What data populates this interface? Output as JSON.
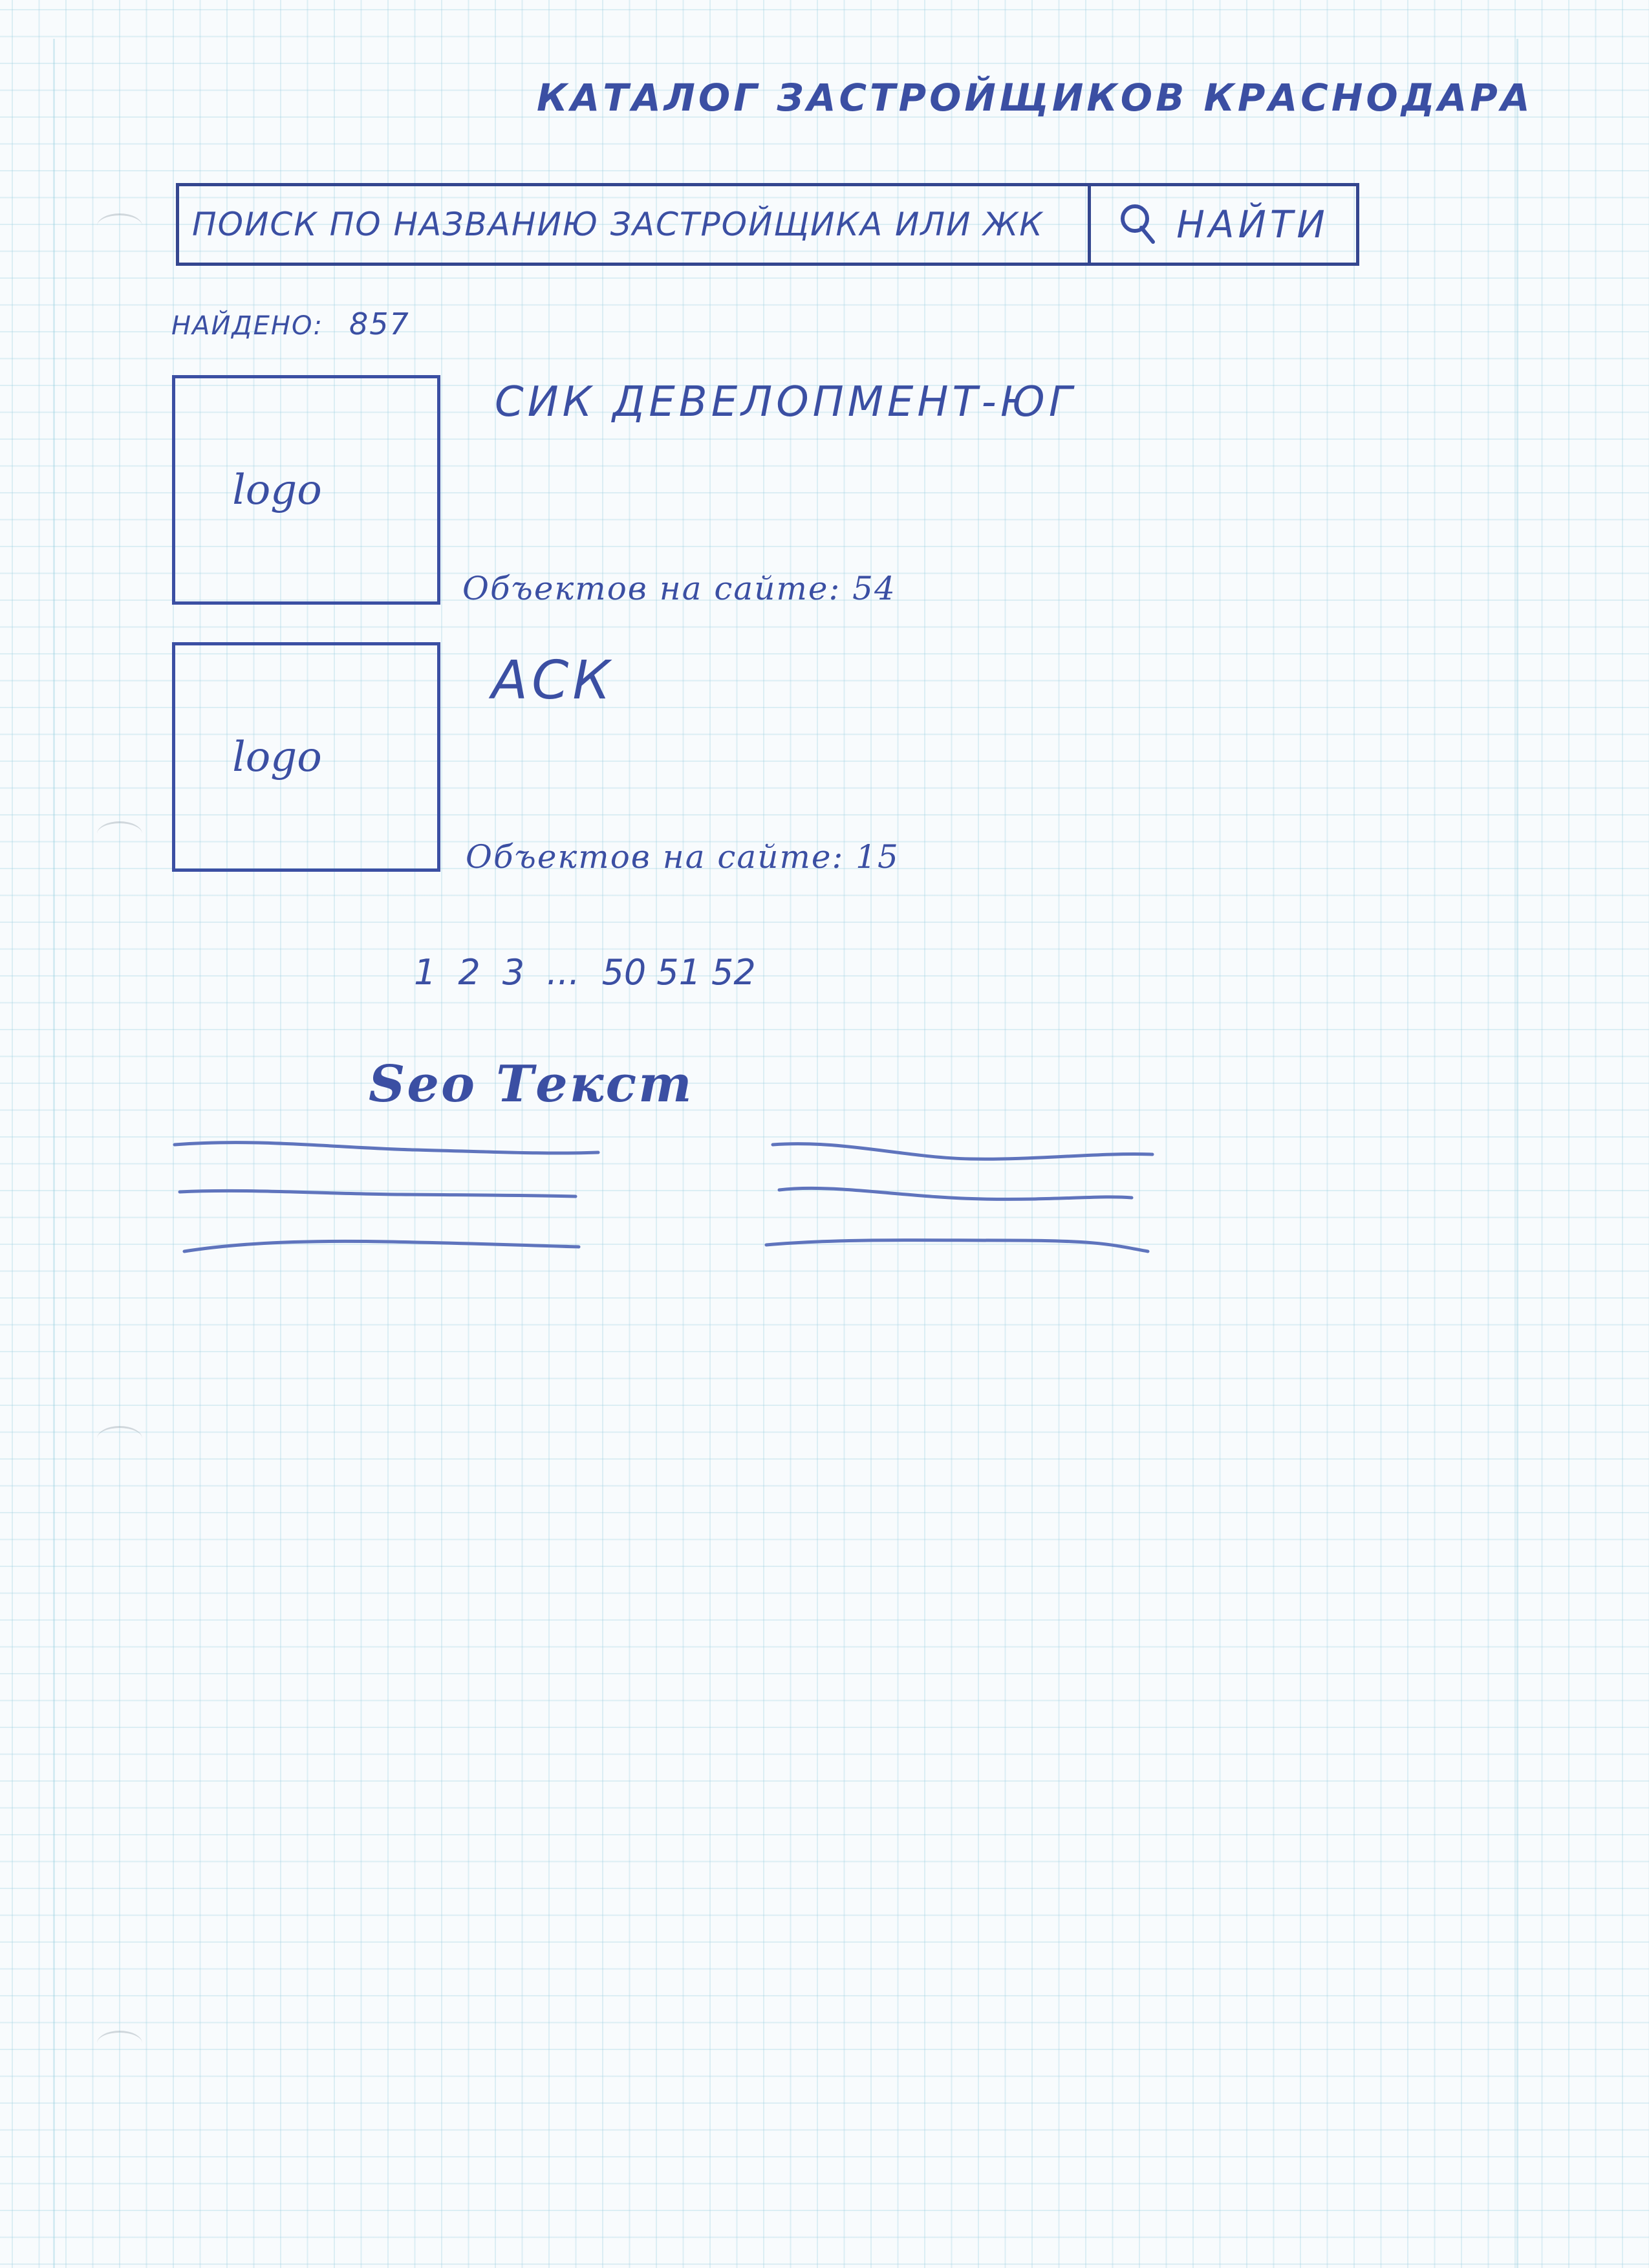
{
  "page": {
    "title": "КАТАЛОГ ЗАСТРОЙЩИКОВ КРАСНОДАРА"
  },
  "search": {
    "placeholder": "ПОИСК ПО НАЗВАНИЮ ЗАСТРОЙЩИКА ИЛИ ЖК",
    "button_label": "НАЙТИ",
    "button_icon": "search-icon"
  },
  "results": {
    "found_label": "НАЙДЕНО:",
    "found_count": "857"
  },
  "developers": [
    {
      "name": "СИК ДЕВЕЛОПМЕНТ-ЮГ",
      "logo_placeholder": "logo",
      "objects_text": "Объектов на сайте: 54"
    },
    {
      "name": "АСК",
      "logo_placeholder": "logo",
      "objects_text": "Объектов на сайте: 15"
    }
  ],
  "pagination": {
    "pages": [
      "1",
      "2",
      "3",
      "...",
      "50",
      "51",
      "52"
    ]
  },
  "seo": {
    "title": "Seo Текст"
  },
  "colors": {
    "ink": "#3b4fa3",
    "grid": "#a0d2e1",
    "paper": "#f8fbfd"
  }
}
